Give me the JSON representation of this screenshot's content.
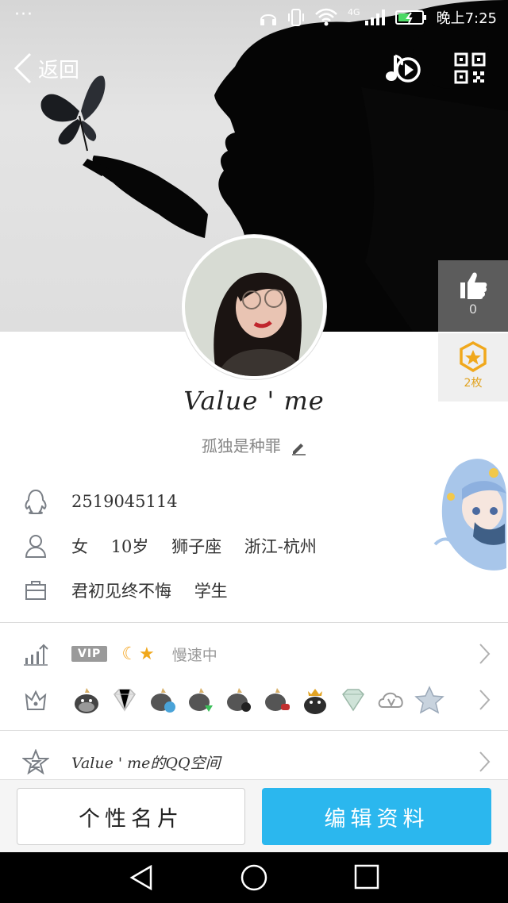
{
  "status_bar": {
    "dots": "···",
    "network": "4G",
    "time": "晚上7:25"
  },
  "nav": {
    "back_label": "返回"
  },
  "like": {
    "count": "0"
  },
  "badge": {
    "count": "2枚"
  },
  "profile": {
    "nickname": "Value ' me",
    "signature": "孤独是种罪",
    "qq_number": "2519045114",
    "gender": "女",
    "age": "10岁",
    "zodiac": "狮子座",
    "location": "浙江-杭州",
    "school": "君初见终不悔",
    "occupation": "学生"
  },
  "vip": {
    "tag": "VIP",
    "speed_text": "慢速中"
  },
  "space": {
    "label": "Value ' me的QQ空间"
  },
  "actions": {
    "card_label": "个性名片",
    "edit_label": "编辑资料"
  },
  "colors": {
    "accent": "#2bb7ee",
    "badge_gold": "#f0a81c"
  }
}
